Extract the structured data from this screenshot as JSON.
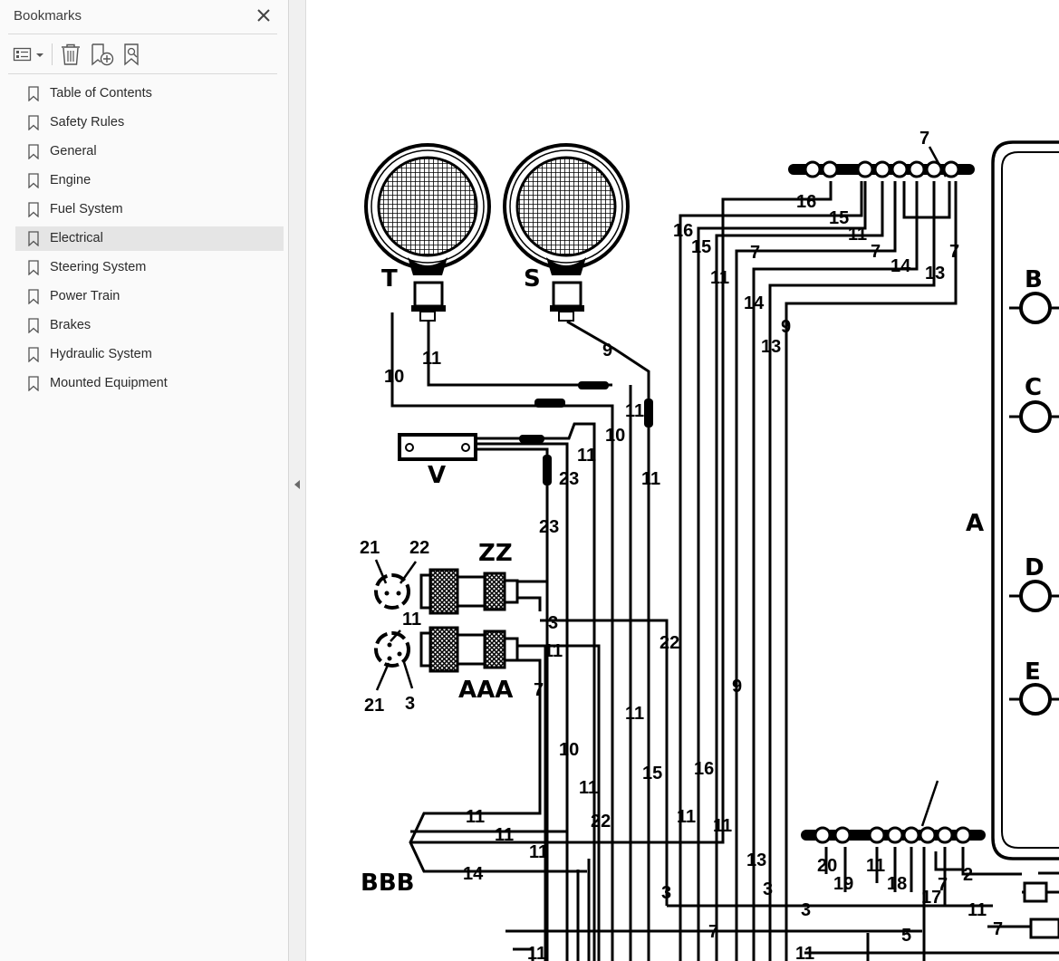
{
  "panel": {
    "title": "Bookmarks",
    "toolbar": {
      "options_icon": "list-options-icon",
      "delete_icon": "trash-icon",
      "new_bookmark_icon": "new-bookmark-icon",
      "find_bookmark_icon": "find-current-bookmark-icon"
    },
    "items": [
      {
        "label": "Table of Contents"
      },
      {
        "label": "Safety Rules"
      },
      {
        "label": "General"
      },
      {
        "label": "Engine"
      },
      {
        "label": "Fuel System"
      },
      {
        "label": "Electrical",
        "selected": true
      },
      {
        "label": "Steering System"
      },
      {
        "label": "Power Train"
      },
      {
        "label": "Brakes"
      },
      {
        "label": "Hydraulic System"
      },
      {
        "label": "Mounted Equipment"
      }
    ]
  },
  "colors": {
    "panel_bg": "#fafafa",
    "selected_bg": "#e5e5e5",
    "text": "#2b2b2b"
  },
  "schematic": {
    "components": [
      "T",
      "S",
      "V",
      "ZZ",
      "AAA",
      "BBB",
      "A",
      "B",
      "C",
      "D",
      "E"
    ],
    "wire_labels": [
      "7",
      "16",
      "15",
      "11",
      "7",
      "14",
      "13",
      "16",
      "15",
      "11",
      "7",
      "14",
      "13",
      "7",
      "9",
      "11",
      "10",
      "9",
      "11",
      "10",
      "11",
      "11",
      "23",
      "23",
      "21",
      "22",
      "11",
      "21",
      "3",
      "3",
      "22",
      "11",
      "7",
      "9",
      "11",
      "10",
      "15",
      "16",
      "11",
      "11",
      "11",
      "22",
      "11",
      "11",
      "11",
      "14",
      "13",
      "3",
      "3",
      "3",
      "11",
      "7",
      "5",
      "20",
      "19",
      "11",
      "18",
      "17",
      "7",
      "2",
      "7",
      "11"
    ]
  }
}
